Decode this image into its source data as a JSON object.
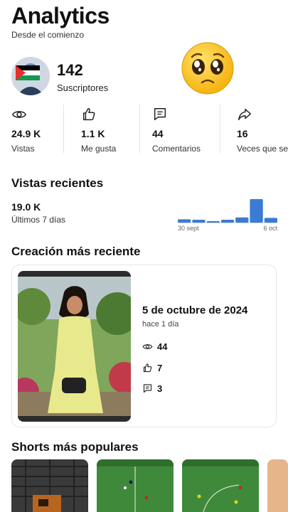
{
  "header": {
    "title": "Analytics",
    "subtitle": "Desde el comienzo"
  },
  "channel": {
    "subscribers_count": "142",
    "subscribers_label": "Suscriptores",
    "avatar_flag_colors": [
      "#000000",
      "#ffffff",
      "#149954",
      "#e4312b"
    ]
  },
  "emoji_icon": "pleading-face-icon",
  "stats": [
    {
      "icon": "eye-icon",
      "value": "24.9 K",
      "label": "Vistas"
    },
    {
      "icon": "thumbs-up-icon",
      "value": "1.1 K",
      "label": "Me gusta"
    },
    {
      "icon": "comment-icon",
      "value": "44",
      "label": "Comentarios"
    },
    {
      "icon": "share-arrow-icon",
      "value": "16",
      "label": "Veces que se"
    }
  ],
  "recent": {
    "heading": "Vistas recientes",
    "views": "19.0 K",
    "period": "Últimos 7 días"
  },
  "chart_data": {
    "type": "bar",
    "color": "#3a7bd5",
    "x_tick_labels": [
      "30 sept",
      "6 oct"
    ],
    "values": [
      0.14,
      0.12,
      0.06,
      0.12,
      0.22,
      1.0,
      0.2
    ]
  },
  "latest": {
    "heading": "Creación más reciente",
    "date": "5 de octubre de 2024",
    "ago": "hace 1 día",
    "views": "44",
    "likes": "7",
    "comments": "3"
  },
  "popular": {
    "heading": "Shorts más populares"
  },
  "colors": {
    "accent": "#3a7bd5",
    "divider": "#e2e2e2",
    "card_border": "#e6e6e6"
  }
}
